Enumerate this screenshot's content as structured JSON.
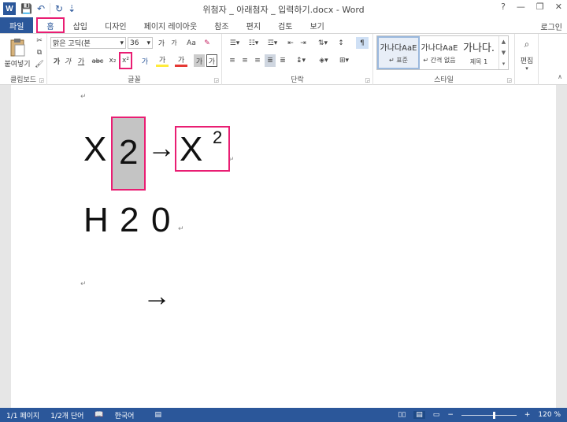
{
  "window": {
    "title": "위첨자 _ 아래첨자 _ 입력하기.docx - Word",
    "app_logo": "W",
    "help": "?",
    "minimize": "—",
    "restore": "❐",
    "close": "✕",
    "login": "로그인"
  },
  "qat": {
    "save_icon": "💾",
    "undo_icon": "↶",
    "redo_icon": "↻",
    "more_icon": "⇣"
  },
  "tabs": [
    {
      "label": "파일"
    },
    {
      "label": "홈"
    },
    {
      "label": "삽입"
    },
    {
      "label": "디자인"
    },
    {
      "label": "페이지 레이아웃"
    },
    {
      "label": "참조"
    },
    {
      "label": "편지"
    },
    {
      "label": "검토"
    },
    {
      "label": "보기"
    }
  ],
  "ribbon": {
    "clipboard": {
      "label": "클립보드",
      "paste": "붙여넣기"
    },
    "font": {
      "label": "글꼴",
      "font_name": "맑은 고딕(본",
      "font_size": "36",
      "grow": "가",
      "shrink": "가",
      "case": "Aa",
      "bold": "가",
      "italic": "가",
      "underline": "가",
      "strike": "abc",
      "subscript": "x₂",
      "superscript": "x²",
      "text_effect": "가",
      "highlight": "가",
      "font_color": "가",
      "char_shade": "가",
      "char_border": "가",
      "phonetic": "가"
    },
    "paragraph": {
      "label": "단락"
    },
    "styles": {
      "label": "스타일",
      "items": [
        {
          "sample": "가나다AaE",
          "name": "↵ 표준"
        },
        {
          "sample": "가나다AaE",
          "name": "↵ 간격 없음"
        },
        {
          "sample": "가나다.",
          "name": "제목 1"
        }
      ]
    },
    "editing": {
      "label": "편집"
    }
  },
  "document": {
    "para_mark": "↵",
    "line1": {
      "x": "X",
      "sub_box": "2",
      "arrow": "→",
      "result_x": "X",
      "result_sup": "2"
    },
    "line2": {
      "h": "H",
      "two": "2",
      "o": "0"
    }
  },
  "status": {
    "page": "1/1 페이지",
    "words": "1/2개 단어",
    "lang": "한국어",
    "zoom": "120 %",
    "zoom_fraction": 0.6,
    "zoom_minus": "−",
    "zoom_plus": "+"
  }
}
